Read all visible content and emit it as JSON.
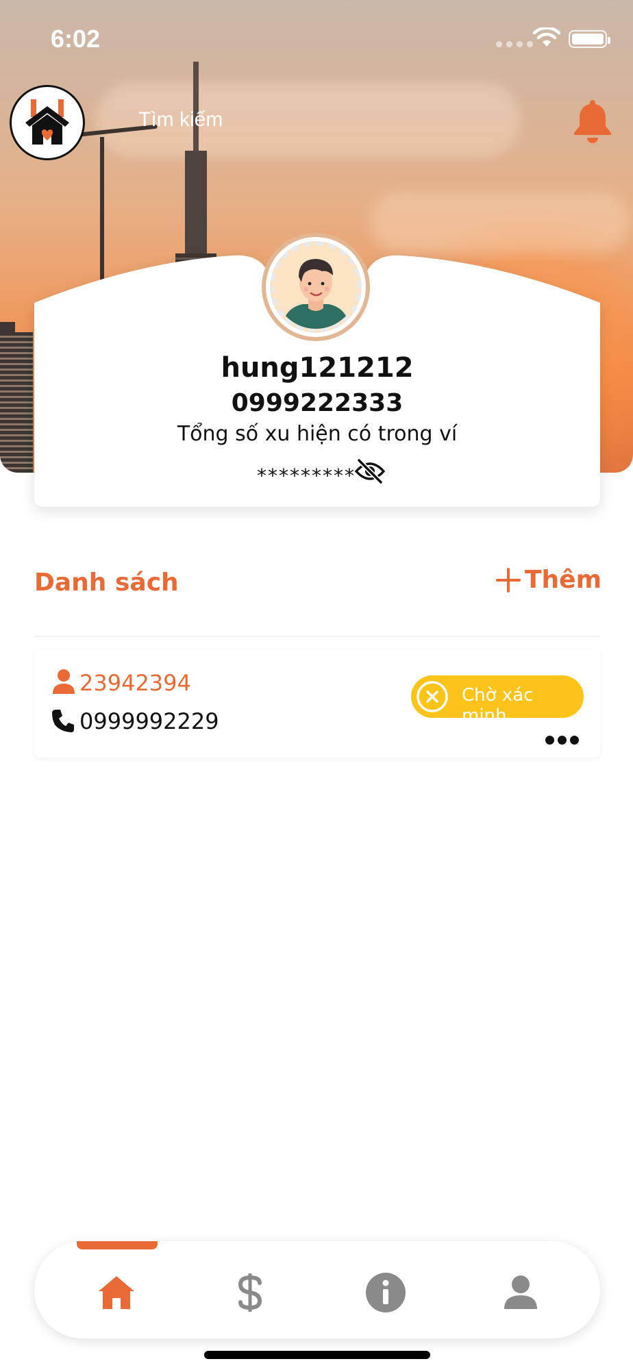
{
  "status_bar": {
    "time": "6:02"
  },
  "header": {
    "search_label": "Tìm kiếm",
    "accent_color": "#e96a34"
  },
  "profile": {
    "username": "hung121212",
    "phone": "0999222333",
    "wallet_label": "Tổng số xu hiện có trong ví",
    "wallet_value": "*********"
  },
  "list": {
    "title": "Danh sách",
    "add_label": "Thêm",
    "items": [
      {
        "id": "23942394",
        "phone": "0999992229",
        "status": "Chờ xác minh",
        "status_color": "#fcc419"
      }
    ]
  },
  "bottom_nav": {
    "items": [
      {
        "icon": "home-icon",
        "active": true
      },
      {
        "icon": "dollar-icon",
        "active": false
      },
      {
        "icon": "info-icon",
        "active": false
      },
      {
        "icon": "user-icon",
        "active": false
      }
    ]
  }
}
